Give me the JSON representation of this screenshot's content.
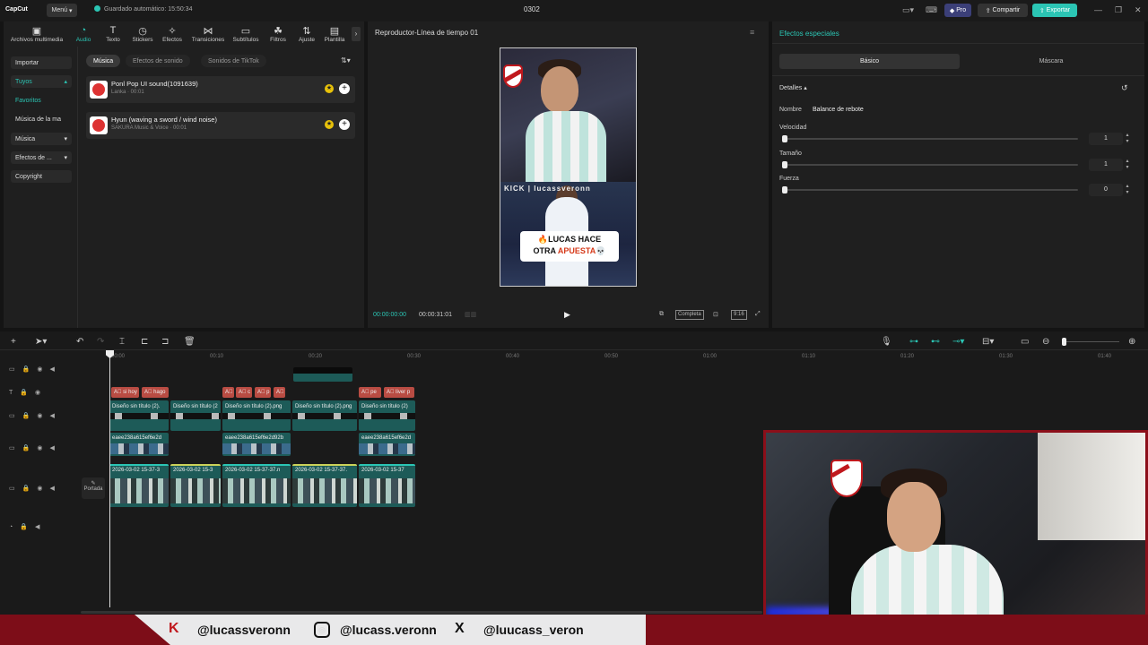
{
  "titlebar": {
    "logo": "CapCut",
    "menu_label": "Menú",
    "autosave": "Guardado automático: 15:50:34",
    "project_title": "0302",
    "pro_label": "Pro",
    "share_label": "Compartir",
    "export_label": "Exportar",
    "colors": {
      "accent": "#2bc5b4",
      "export_bg": "#2bc5b4",
      "pro_bg": "#3b3f78"
    }
  },
  "toolbar": {
    "items": [
      {
        "label": "Archivos multimedia",
        "icon": "media-icon"
      },
      {
        "label": "Audio",
        "icon": "audio-icon"
      },
      {
        "label": "Texto",
        "icon": "text-icon"
      },
      {
        "label": "Stickers",
        "icon": "sticker-icon"
      },
      {
        "label": "Efectos",
        "icon": "effects-icon"
      },
      {
        "label": "Transiciones",
        "icon": "transition-icon"
      },
      {
        "label": "Subtítulos",
        "icon": "subtitle-icon"
      },
      {
        "label": "Filtros",
        "icon": "filter-icon"
      },
      {
        "label": "Ajuste",
        "icon": "adjust-icon"
      },
      {
        "label": "Plantilla",
        "icon": "template-icon"
      }
    ]
  },
  "sidebar": {
    "items": [
      "Importar",
      "Tuyos",
      "Favoritos",
      "Música de la ma",
      "Música",
      "Efectos de ...",
      "Copyright"
    ]
  },
  "audio": {
    "chips": [
      "Música",
      "Efectos de sonido",
      "Sonidos de TikTok"
    ],
    "tracks": [
      {
        "name": "Ponl Pop UI sound(1091639)",
        "artist": "Lanka · 00:01"
      },
      {
        "name": "Hyun (waving a sword / wind noise)",
        "artist": "SAKURA Music & Voice · 00:01"
      }
    ]
  },
  "player": {
    "title": "Reproductor-Línea de tiempo 01",
    "time_current": "00:00:00:00",
    "time_total": "00:00:31:01",
    "full_label": "Completa",
    "ratio_label": "9:16",
    "overlay_kick": "KICK | lucassveronn",
    "caption_line1": "LUCAS HACE",
    "caption_line2_a": "OTRA",
    "caption_line2_b": "APUESTA"
  },
  "effects": {
    "title": "Efectos especiales",
    "tab_basic": "Básico",
    "tab_mask": "Máscara",
    "details_label": "Detalles",
    "name_label": "Nombre",
    "name_value": "Balance de rebote",
    "params": [
      {
        "label": "Velocidad",
        "value": "1",
        "level": 0.0
      },
      {
        "label": "Tamaño",
        "value": "1",
        "level": 0.0
      },
      {
        "label": "Fuerza",
        "value": "0",
        "level": 0.0
      }
    ]
  },
  "timeline": {
    "ruler": [
      "00:00",
      "00:10",
      "00:20",
      "00:30",
      "00:40",
      "00:50",
      "01:00",
      "01:10",
      "01:20",
      "01:30",
      "01:40"
    ],
    "text_clips": [
      "si hoy",
      "hago",
      "",
      "c",
      "p",
      "",
      "pe",
      "liver p"
    ],
    "image_clips": [
      "Diseño sin título (2).",
      "Diseño sin título (2",
      "Diseño sin título (2).png",
      "Diseño sin título (2).png",
      "Diseño sin título (2)"
    ],
    "overlay_clips": [
      "eaee238a615ef6e2d",
      "eaee238a615ef6e2d92b",
      "eaee238a615ef6e2d"
    ],
    "main_clips": [
      "2026-03-02 15-37-3",
      "2026-03-02 15-3",
      "2026-03-02 15-37-37.n",
      "2026-03-02 15-37-37.",
      "2026-03-02 15-37"
    ],
    "cover_label": "Portada"
  },
  "social": {
    "kick": "@lucassveronn",
    "instagram": "@lucass.veronn",
    "x": "@luucass_veron"
  }
}
